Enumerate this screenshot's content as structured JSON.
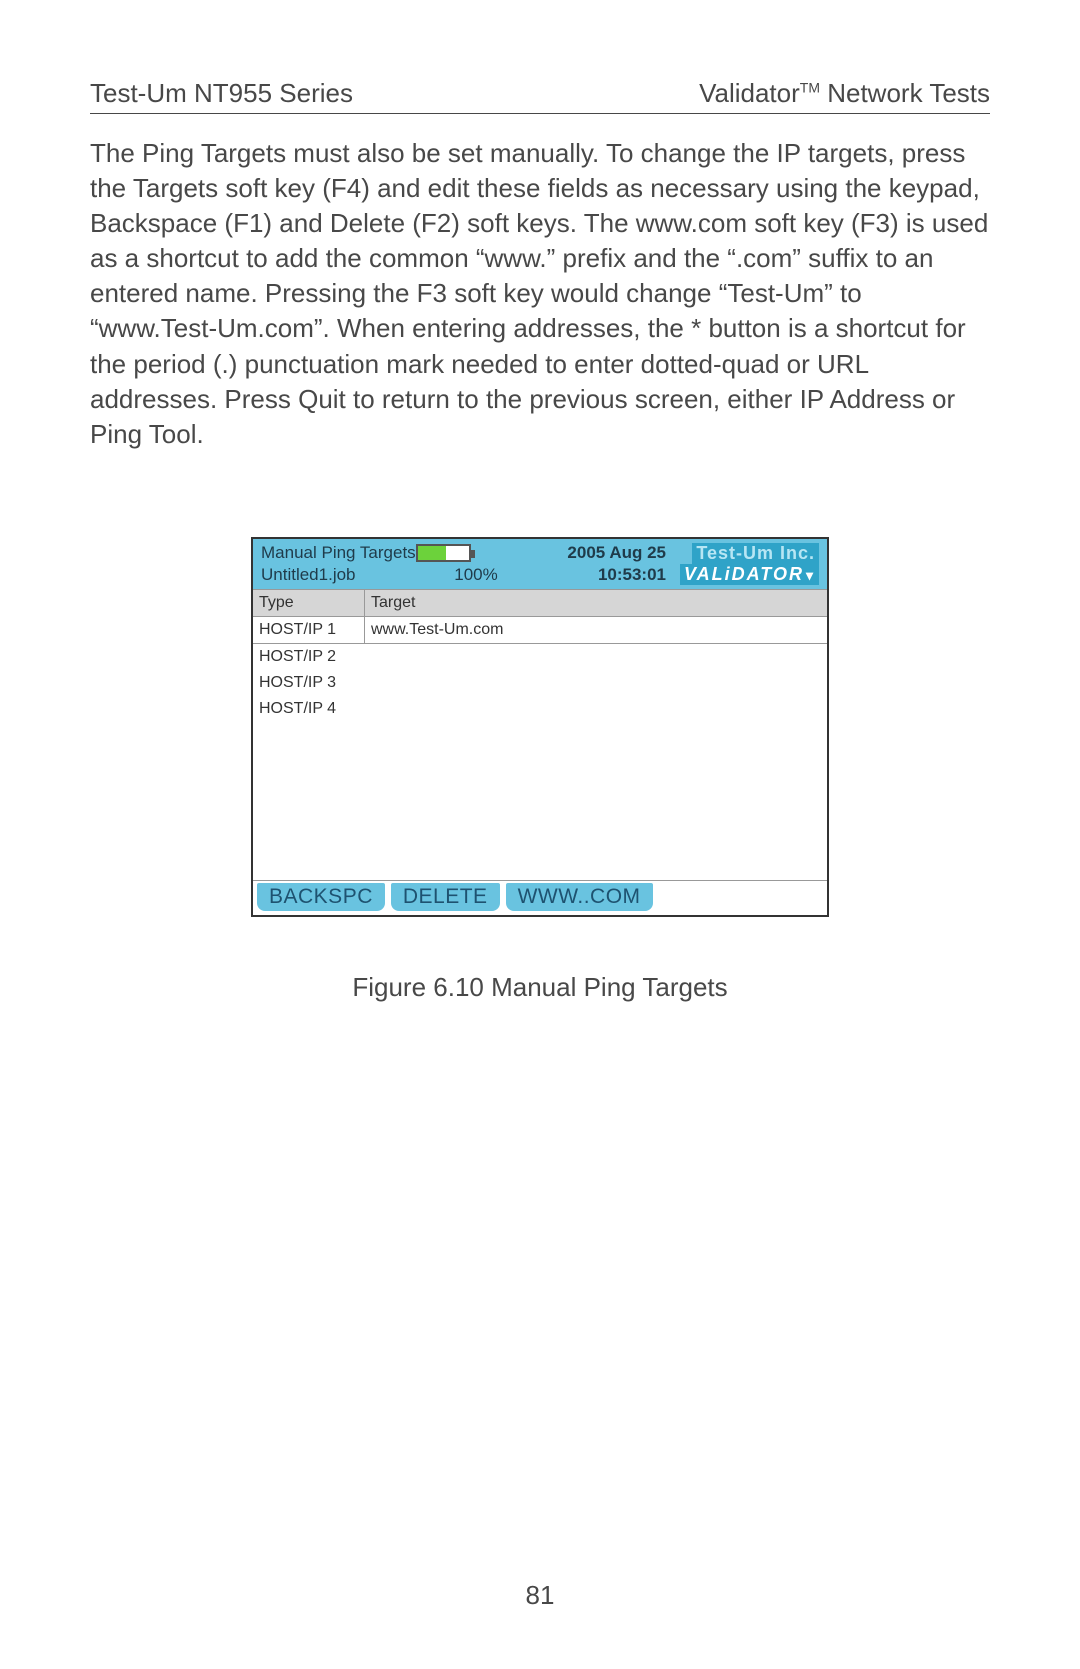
{
  "header": {
    "left": "Test-Um NT955 Series",
    "right_pre": "Validator",
    "right_sup": "TM",
    "right_post": " Network Tests"
  },
  "body_text": "The Ping Targets must also be set manually.  To change the IP targets, press the Targets soft key (F4) and edit these fields as necessary using the keypad, Backspace (F1) and Delete (F2) soft keys.  The www.com soft key (F3) is used as a shortcut to add the common “www.” prefix and the “.com” suffix to an entered name.  Pressing the F3 soft key would change “Test-Um” to “www.Test-Um.com”.  When entering addresses, the * button is a shortcut for the period (.) punctuation mark needed to enter dotted-quad or URL addresses.  Press Quit to return to the previous screen, either IP Address or Ping Tool.",
  "device": {
    "title": "Manual Ping Targets",
    "file": "Untitled1.job",
    "percent": "100%",
    "date": "2005 Aug 25",
    "time": "10:53:01",
    "brand_top": "Test-Um Inc.",
    "brand_bot": "VALiDATOR",
    "columns": {
      "type": "Type",
      "target": "Target"
    },
    "rows": [
      {
        "type": "HOST/IP 1",
        "target": "www.Test-Um.com"
      },
      {
        "type": "HOST/IP 2",
        "target": ""
      },
      {
        "type": "HOST/IP 3",
        "target": ""
      },
      {
        "type": "HOST/IP 4",
        "target": ""
      }
    ],
    "softkeys": {
      "f1": "BACKSPC",
      "f2": "DELETE",
      "f3": "WWW..COM"
    }
  },
  "figure_caption": "Figure 6.10 Manual Ping Targets",
  "page_number": "81"
}
